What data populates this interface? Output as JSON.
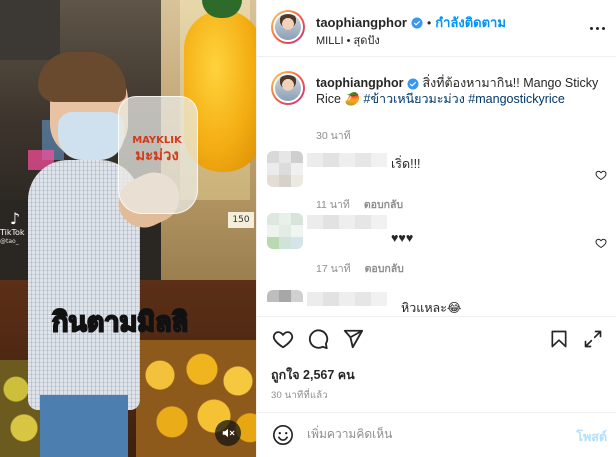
{
  "media": {
    "overlay_caption": "กินตามมิลลิ",
    "bag_text_top": "MAYKLIK",
    "bag_text_bottom": "มะม่วง",
    "price_tag": "150",
    "tiktok_logo": "tiktok-logo",
    "tiktok_name": "TikTok",
    "tiktok_handle": "@tao_",
    "mute_icon": "speaker-muted-icon"
  },
  "header": {
    "username": "taophiangphor",
    "verified": true,
    "separator": "•",
    "follow_label": "กำลังติดตาม",
    "subtitle": "MILLI • สุดปัง",
    "more_icon": "more-horizontal-icon"
  },
  "caption": {
    "username": "taophiangphor",
    "text": "สิ่งที่ต้องหามากิน!! Mango Sticky Rice ",
    "emoji": "🥭",
    "hashtags": [
      "#ข้าวเหนียวมะม่วง",
      "#mangostickyrice"
    ],
    "time": "30 นาที"
  },
  "comments": [
    {
      "text": "เริ่ด!!!",
      "time": "11 นาที",
      "reply_label": "ตอบกลับ"
    },
    {
      "text": "♥♥♥",
      "time": "17 นาที",
      "reply_label": "ตอบกลับ"
    },
    {
      "text": "หิวแหละ😂",
      "time": "",
      "reply_label": ""
    }
  ],
  "actions": {
    "like_icon": "heart-icon",
    "comment_icon": "comment-icon",
    "share_icon": "share-icon",
    "save_icon": "bookmark-icon",
    "likes_text": "ถูกใจ 2,567 คน",
    "post_time": "30 นาทีที่แล้ว"
  },
  "add_comment": {
    "emoji_icon": "smiley-icon",
    "placeholder": "เพิ่มความคิดเห็น",
    "post_label": "โพสต์"
  },
  "colors": {
    "accent": "#0095f6",
    "hashtag": "#00376b",
    "muted": "#8e8e8e",
    "post_disabled": "#b2dffc"
  }
}
